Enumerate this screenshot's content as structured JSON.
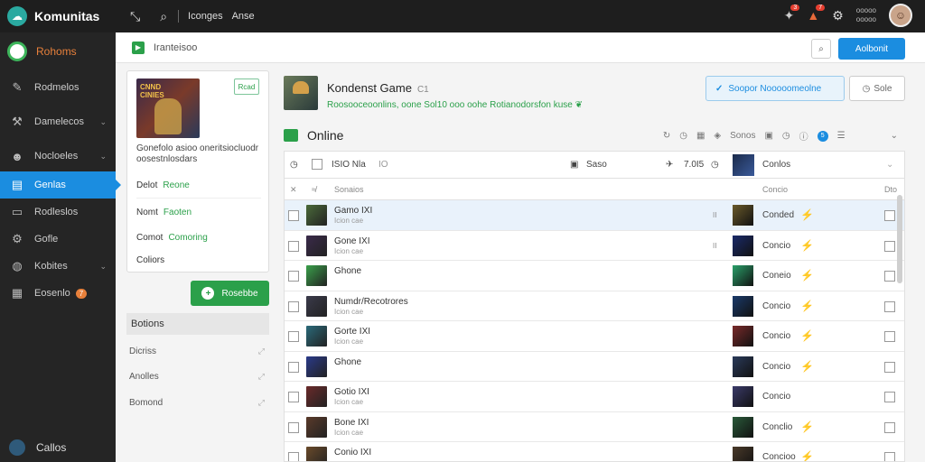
{
  "app": {
    "name": "Komunitas"
  },
  "topbar": {
    "links": [
      "Iconges",
      "Anse"
    ],
    "badges": [
      "3",
      "7"
    ],
    "user_lines": [
      "ooooo",
      "ooooo"
    ]
  },
  "sidebar": {
    "profile_label": "Rohoms",
    "items": [
      {
        "label": "Rodmelos",
        "icon": "brush-icon",
        "chevron": false
      },
      {
        "label": "Damelecos",
        "icon": "hammer-icon",
        "chevron": true
      },
      {
        "label": "Nocloeles",
        "icon": "people-icon",
        "chevron": true
      },
      {
        "label": "Genlas",
        "icon": "book-icon",
        "chevron": false,
        "active": true
      },
      {
        "label": "Rodleslos",
        "icon": "display-icon",
        "chevron": false
      },
      {
        "label": "Gofle",
        "icon": "gear-icon",
        "chevron": false
      },
      {
        "label": "Kobites",
        "icon": "globe-icon",
        "chevron": true
      },
      {
        "label": "Eosenlo",
        "icon": "grid-icon",
        "chevron": false,
        "badge": "7"
      }
    ],
    "bottom_label": "Callos"
  },
  "subheader": {
    "title": "Iranteisoo",
    "primary_button": "Aolbonit"
  },
  "game_card": {
    "art_title": "CNND\nCINIES",
    "tag": "Rcad",
    "description": "Gonefolo asioo oneritsiocluodr oosestnlosdars",
    "rows": [
      {
        "label": "Delot",
        "value": "Reone"
      },
      {
        "label": "Nomt",
        "value": "Faoten"
      },
      {
        "label": "Comot",
        "value": "Comoring"
      },
      {
        "label": "Coliors",
        "value": ""
      }
    ]
  },
  "add_button": "Rosebbe",
  "sections": {
    "title": "Botions",
    "items": [
      "Dicriss",
      "Anolles",
      "Bomond"
    ]
  },
  "game_header": {
    "title": "Kondenst Game",
    "subtitle": "C1",
    "description": "Roosooceoonlins, oone Sol10 ooo oohe Rotianodorsfon kuse",
    "follow_button": "Soopor Nooooomeolne",
    "secondary_button": "Sole"
  },
  "online": {
    "title": "Online",
    "tools_label": "Sonos",
    "count": "5"
  },
  "table": {
    "filter": {
      "col1": "ISIO Nla",
      "col1b": "IO",
      "col2": "Saso",
      "col3": "7.0I5",
      "col4": "Conlos"
    },
    "columns": {
      "name": "Sonaios",
      "status": "Concio",
      "action": "Dto"
    },
    "rows": [
      {
        "name": "Gamo IXI",
        "sub": "Icion cae",
        "ii": "II",
        "status": "Conded",
        "bolt": true,
        "highlight": true,
        "thumb_a": "#4a6a3a",
        "thumb_b": "#6a5a2a"
      },
      {
        "name": "Gone IXI",
        "sub": "Icion cae",
        "ii": "II",
        "status": "Concio",
        "bolt": true,
        "highlight": false,
        "thumb_a": "#3a2a4a",
        "thumb_b": "#1a2a6a"
      },
      {
        "name": "Ghone",
        "sub": "",
        "ii": "",
        "status": "Coneio",
        "bolt": true,
        "highlight": false,
        "thumb_a": "#3aa04a",
        "thumb_b": "#2aa06a"
      },
      {
        "name": "Numdr/Recotrores",
        "sub": "Icion cae",
        "ii": "",
        "status": "Concio",
        "bolt": true,
        "highlight": false,
        "thumb_a": "#3a3a4a",
        "thumb_b": "#1a3a6a"
      },
      {
        "name": "Gorte IXI",
        "sub": "Icion cae",
        "ii": "",
        "status": "Concio",
        "bolt": true,
        "highlight": false,
        "thumb_a": "#2a6a7a",
        "thumb_b": "#7a2a2a"
      },
      {
        "name": "Ghone",
        "sub": "",
        "ii": "",
        "status": "Concio",
        "bolt": true,
        "highlight": false,
        "thumb_a": "#2a3a8a",
        "thumb_b": "#2a3a5a"
      },
      {
        "name": "Gotio IXI",
        "sub": "Icion cae",
        "ii": "",
        "status": "Concio",
        "bolt": false,
        "highlight": false,
        "thumb_a": "#6a2a2a",
        "thumb_b": "#3a3a6a"
      },
      {
        "name": "Bone IXI",
        "sub": "Icion cae",
        "ii": "",
        "status": "Conclio",
        "bolt": true,
        "highlight": false,
        "thumb_a": "#5a3a2a",
        "thumb_b": "#2a5a3a"
      },
      {
        "name": "Conio IXI",
        "sub": "",
        "ii": "",
        "status": "Concioo",
        "bolt": true,
        "highlight": false,
        "thumb_a": "#6a4a2a",
        "thumb_b": "#4a3a2a"
      }
    ]
  },
  "colors": {
    "accent": "#1b8de0",
    "green": "#2ba04a",
    "orange": "#e7803b",
    "dark": "#1e1e1e"
  }
}
